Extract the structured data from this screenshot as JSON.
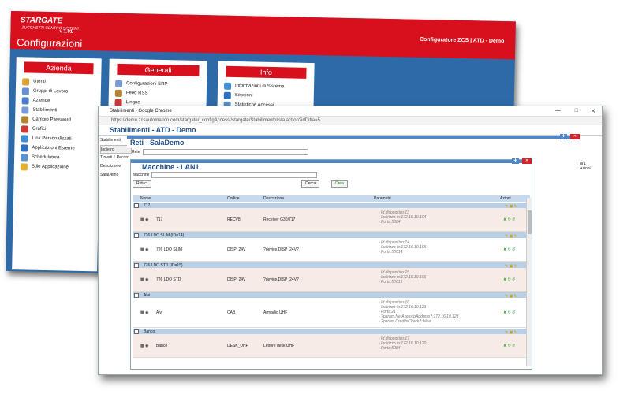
{
  "config_window": {
    "logo": "STARGATE",
    "logo_sub": "ZUCCHETTI CENTRO SISTEMI",
    "version": "v 1.01",
    "title": "Configurazioni",
    "right_info": "Configuratore ZCS  |  ATD - Demo",
    "panels": [
      {
        "title": "Azienda",
        "items": [
          "Utenti",
          "Gruppi di Lavoro",
          "Aziende",
          "Stabilimenti",
          "Cambio Password",
          "Grafici",
          "Link Personalizzati",
          "Applicazioni Esterne",
          "Schedulatore",
          "Stile Applicazione"
        ]
      },
      {
        "title": "Generali",
        "items": [
          "Configurazioni ERP",
          "Feed RSS",
          "Lingue"
        ]
      },
      {
        "title": "Info",
        "items": [
          "Informazioni di Sistema",
          "Sessioni",
          "Statistiche Accessi"
        ]
      }
    ],
    "icon_colors": [
      "#d9a23b",
      "#6b8fd1",
      "#4a7ec9",
      "#7a9ad8",
      "#b1852f",
      "#cc3a3a",
      "#3f8fd6",
      "#2f6fc0",
      "#5a8fd0",
      "#e0b030"
    ]
  },
  "chrome": {
    "window_title": "Stabilimenti - Google Chrome",
    "url": "https://demo.zcsautomation.com/stargate/_configAccessi/stargate/Stabilimentolista.action?idDitta=5",
    "page_title": "Stabilimenti - ATD - Demo",
    "left_labels": [
      "Stabilimenti",
      "Indietro",
      "Trovati 1 Record",
      "Descrizione",
      "SalaDemo"
    ],
    "right_labels": [
      "di 1",
      "Azioni"
    ]
  },
  "reti": {
    "title": "Reti - SalaDemo",
    "field_label": "Rete"
  },
  "macchine": {
    "title": "Macchine - LAN1",
    "field_label": "Macchine",
    "reduce_label": "Riduci",
    "search_label": "Cerca",
    "create_label": "Crea",
    "columns": {
      "name": "Nome",
      "code": "Codice",
      "desc": "Descrizione",
      "params": "Parametri",
      "actions": "Azioni"
    },
    "groups": [
      {
        "group": "717",
        "name": "717",
        "code": "RECV8",
        "desc": "Receiver G30/717",
        "params": [
          "- Id dispositivo:13",
          "- Indirizzo ip:172.16.10.104",
          "- Porta:5084"
        ],
        "row": "pink"
      },
      {
        "group": "726 LDO SLIM (ID=14)",
        "name": "726 LDO SLIM",
        "code": "DISP_24V",
        "desc": "?device.DISP_24V?",
        "params": [
          "- Id dispositivo:14",
          "- Indirizzo ip:172.16.10.105",
          "- Porta:50014"
        ],
        "row": "white"
      },
      {
        "group": "726 LDO STD (ID=15)",
        "name": "726 LDO STD",
        "code": "DISP_24V",
        "desc": "?device.DISP_24V?",
        "params": [
          "- Id dispositivo:15",
          "- Indirizzo ip:172.16.10.106",
          "- Porta:50015"
        ],
        "row": "pink"
      },
      {
        "group": "Alvi",
        "name": "Alvi",
        "code": "CAB",
        "desc": "Armadio UHF",
        "params": [
          "- Id dispositivo:16",
          "- Indirizzo ip:172.16.10.123",
          "- Porta:21",
          "- ?param.NetAxessIpAddress?:172.16.10.123",
          "- ?param.CreditsCheck?:false"
        ],
        "row": "white"
      },
      {
        "group": "Banco",
        "name": "Banco",
        "code": "DESK_UHF",
        "desc": "Lettore desk UHF",
        "params": [
          "- Id dispositivo:17",
          "- Indirizzo ip:172.16.10.120",
          "- Porta:5084"
        ],
        "row": "pink"
      }
    ]
  }
}
